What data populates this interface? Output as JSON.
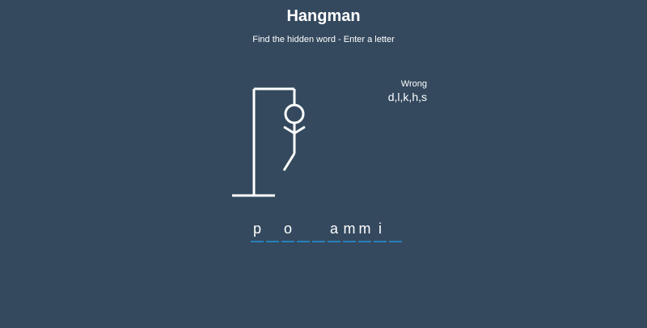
{
  "header": {
    "title": "Hangman",
    "subtitle": "Find the hidden word - Enter a letter"
  },
  "hangman": {
    "wrong_count": 5,
    "parts_shown": [
      "head",
      "body",
      "left-arm",
      "right-arm",
      "left-leg"
    ]
  },
  "wrong_panel": {
    "label": "Wrong",
    "letters": "d,l,k,h,s"
  },
  "word": {
    "slots": [
      "p",
      "",
      "o",
      "",
      "",
      "a",
      "m",
      "m",
      "i",
      ""
    ]
  },
  "colors": {
    "background": "#34495e",
    "underline": "#2980b9",
    "figure": "#ffffff"
  }
}
